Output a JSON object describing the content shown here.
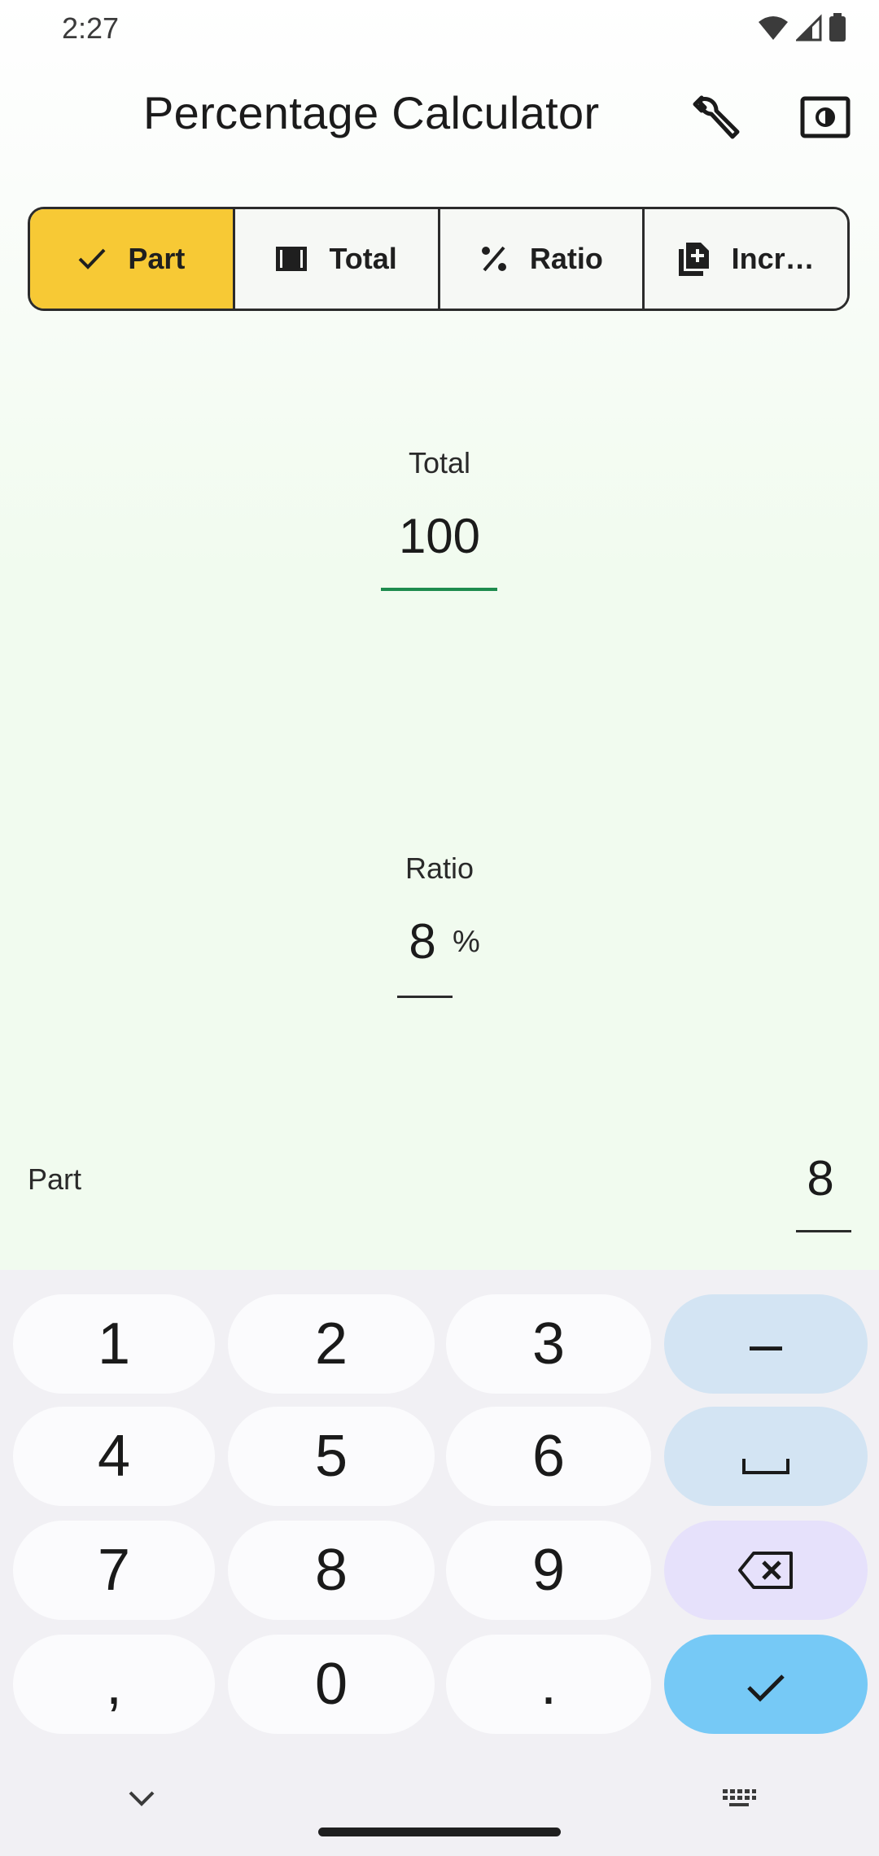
{
  "status_bar": {
    "time": "2:27"
  },
  "app_bar": {
    "title": "Percentage Calculator"
  },
  "segments": [
    {
      "label": "Part",
      "icon": "check-icon",
      "selected": true
    },
    {
      "label": "Total",
      "icon": "film-icon",
      "selected": false
    },
    {
      "label": "Ratio",
      "icon": "percent-icon",
      "selected": false
    },
    {
      "label": "Incr…",
      "icon": "note-add-icon",
      "selected": false
    }
  ],
  "fields": {
    "total": {
      "label": "Total",
      "value": "100"
    },
    "ratio": {
      "label": "Ratio",
      "value": "8",
      "suffix": "%"
    },
    "part": {
      "label": "Part",
      "value": "8"
    }
  },
  "keyboard": {
    "keys": [
      "1",
      "2",
      "3",
      "–",
      "4",
      "5",
      "6",
      "␣",
      "7",
      "8",
      "9",
      "backspace",
      ",",
      "0",
      ".",
      "enter"
    ],
    "side_keys": {
      "minus": "–",
      "space": "⎵"
    }
  },
  "colors": {
    "accent_selected": "#f7c935",
    "focus_underline": "#1e8b4e",
    "enter_key": "#76c9f6",
    "side_key": "#d3e4f3",
    "delete_key": "#e6e1fb"
  }
}
